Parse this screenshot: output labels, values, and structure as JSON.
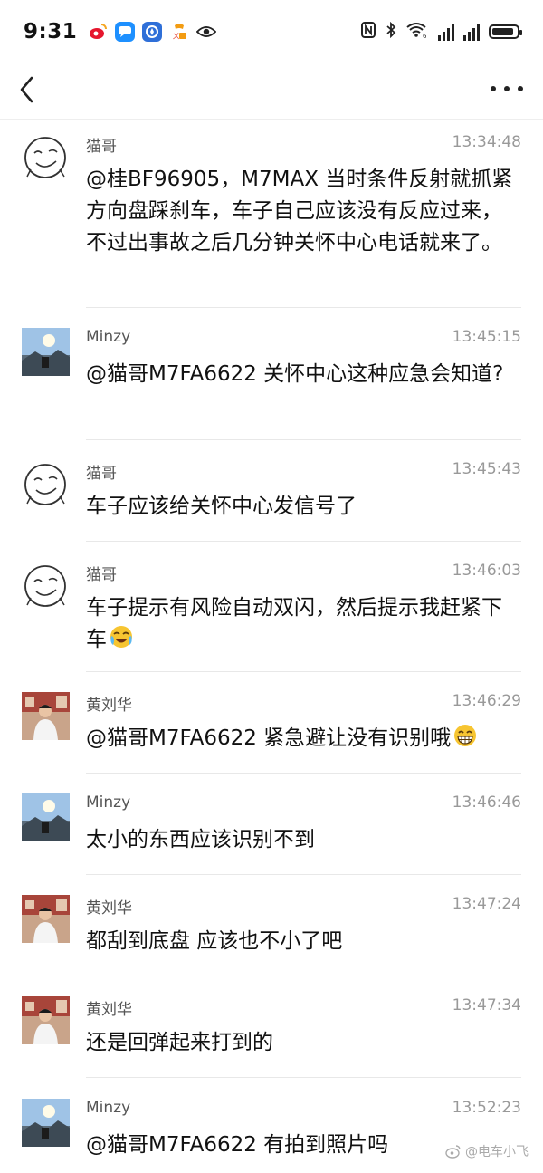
{
  "status_bar": {
    "time": "9:31",
    "apps": [
      "weibo-icon",
      "message-icon",
      "compass-icon",
      "shop-icon",
      "eye-icon"
    ],
    "indicators": [
      "nfc-icon",
      "bluetooth-icon",
      "wifi-icon",
      "signal-icon",
      "signal-icon",
      "battery-icon"
    ],
    "battery_level": 0.9
  },
  "nav": {
    "back_icon": "chevron-left-icon",
    "more_icon": "more-icon"
  },
  "comments": [
    {
      "author": "猫哥",
      "time": "13:34:48",
      "text": "@桂BF96905，M7MAX 当时条件反射就抓紧方向盘踩刹车，车子自己应该没有反应过来，不过出事故之后几分钟关怀中心电话就来了。",
      "avatar": "sketch-face"
    },
    {
      "author": "Minzy",
      "time": "13:45:15",
      "text": "@猫哥M7FA6622 关怀中心这种应急会知道?",
      "avatar": "mountain-photo"
    },
    {
      "author": "猫哥",
      "time": "13:45:43",
      "text": "车子应该给关怀中心发信号了",
      "avatar": "sketch-face"
    },
    {
      "author": "猫哥",
      "time": "13:46:03",
      "text": "车子提示有风险自动双闪，然后提示我赶紧下车",
      "emoji": "crying-laughing-emoji",
      "avatar": "sketch-face"
    },
    {
      "author": "黄刘华",
      "time": "13:46:29",
      "text": "@猫哥M7FA6622 紧急避让没有识别哦",
      "emoji": "grinning-emoji",
      "avatar": "person-photo"
    },
    {
      "author": "Minzy",
      "time": "13:46:46",
      "text": "太小的东西应该识别不到",
      "avatar": "mountain-photo"
    },
    {
      "author": "黄刘华",
      "time": "13:47:24",
      "text": "都刮到底盘 应该也不小了吧",
      "avatar": "person-photo"
    },
    {
      "author": "黄刘华",
      "time": "13:47:34",
      "text": "还是回弹起来打到的",
      "avatar": "person-photo"
    },
    {
      "author": "Minzy",
      "time": "13:52:23",
      "text": "@猫哥M7FA6622 有拍到照片吗",
      "avatar": "mountain-photo"
    }
  ],
  "watermark": "@电车小飞"
}
